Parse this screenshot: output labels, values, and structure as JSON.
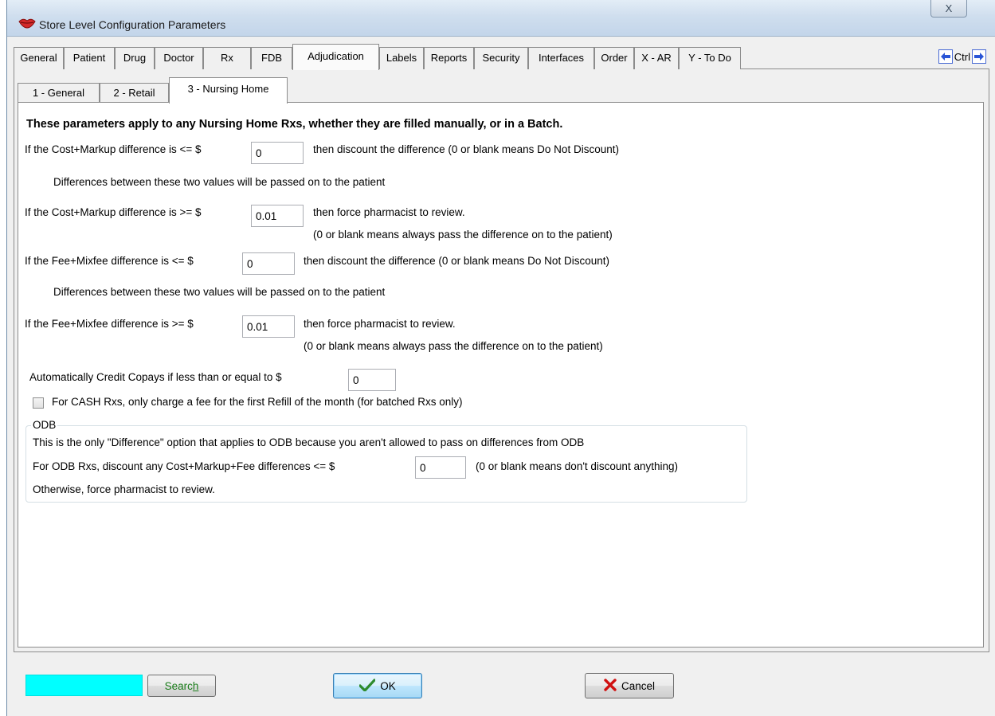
{
  "window": {
    "title": "Store Level Configuration Parameters",
    "close_glyph": "X"
  },
  "main_tabs": [
    {
      "label": "General"
    },
    {
      "label": "Patient"
    },
    {
      "label": "Drug"
    },
    {
      "label": "Doctor"
    },
    {
      "label": "Rx"
    },
    {
      "label": "FDB"
    },
    {
      "label": "Adjudication"
    },
    {
      "label": "Labels"
    },
    {
      "label": "Reports"
    },
    {
      "label": "Security"
    },
    {
      "label": "Interfaces"
    },
    {
      "label": "Order"
    },
    {
      "label": "X - AR"
    },
    {
      "label": "Y - To Do"
    }
  ],
  "active_main_tab": "Adjudication",
  "ctrl_nav": {
    "label": "Ctrl"
  },
  "sub_tabs": [
    {
      "label": "1 - General"
    },
    {
      "label": "2 - Retail"
    },
    {
      "label": "3 - Nursing Home"
    }
  ],
  "active_sub_tab": "3 - Nursing Home",
  "form": {
    "heading": "These parameters apply to any Nursing Home Rxs, whether they are filled manually, or in a Batch.",
    "cost_markup_le_label": "If the Cost+Markup difference is <= $",
    "cost_markup_le_value": "0",
    "cost_markup_le_suffix": "then discount the difference (0 or blank means Do Not Discount)",
    "cost_markup_note": "Differences between these two values will be passed on to the patient",
    "cost_markup_ge_label": "If the Cost+Markup difference is >= $",
    "cost_markup_ge_value": "0.01",
    "cost_markup_ge_suffix": "then force pharmacist to review.",
    "cost_markup_ge_note": "(0 or blank means always pass the difference on to the patient)",
    "fee_mixfee_le_label": "If the Fee+Mixfee difference is <= $",
    "fee_mixfee_le_value": "0",
    "fee_mixfee_le_suffix": "then discount the difference (0 or blank means Do Not Discount)",
    "fee_mixfee_note": "Differences between these two values will be passed on to the patient",
    "fee_mixfee_ge_label": "If the Fee+Mixfee difference is >= $",
    "fee_mixfee_ge_value": "0.01",
    "fee_mixfee_ge_suffix": "then force pharmacist to review.",
    "fee_mixfee_ge_note": "(0 or blank means always pass the difference on to the patient)",
    "auto_credit_label": "Automatically Credit Copays if less than or equal to $",
    "auto_credit_value": "0",
    "cash_rx_checkbox_label": "For CASH Rxs, only charge a fee for the first Refill of the month (for batched Rxs only)",
    "cash_rx_checked": false
  },
  "odb": {
    "legend": "ODB",
    "line1": "This is the only \"Difference\" option that applies to ODB because you aren't allowed to pass on differences from ODB",
    "discount_label": "For ODB Rxs, discount any Cost+Markup+Fee differences <= $",
    "discount_value": "0",
    "discount_suffix": "(0 or blank means don't discount anything)",
    "line3": "Otherwise, force pharmacist to review."
  },
  "footer": {
    "search_label_pre": "Searc",
    "search_label_underlined": "h",
    "ok_label": "OK",
    "cancel_label": "Cancel"
  },
  "colors": {
    "search_box": "#00ffff",
    "ok_check": "#2e8b2e",
    "cancel_x": "#d01010",
    "nav_arrow": "#2a55d6"
  },
  "icons": {
    "app": "red-lips-icon",
    "ok": "checkmark-icon",
    "cancel": "red-x-icon",
    "nav_left": "arrow-left-icon",
    "nav_right": "arrow-right-icon"
  }
}
